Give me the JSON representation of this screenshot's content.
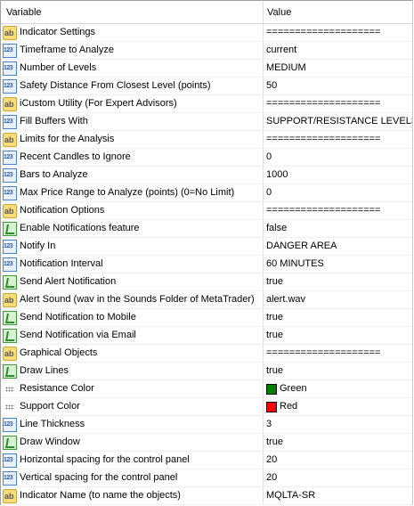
{
  "header": {
    "variable": "Variable",
    "value": "Value"
  },
  "rows": [
    {
      "icon": "ab",
      "label": "Indicator Settings",
      "value": "===================="
    },
    {
      "icon": "num",
      "label": "Timeframe to Analyze",
      "value": "current"
    },
    {
      "icon": "num",
      "label": "Number of Levels",
      "value": "MEDIUM"
    },
    {
      "icon": "num",
      "label": "Safety Distance From Closest Level (points)",
      "value": "50"
    },
    {
      "icon": "ab",
      "label": "iCustom Utility (For Expert Advisors)",
      "value": "===================="
    },
    {
      "icon": "num",
      "label": "Fill Buffers With",
      "value": "SUPPORT/RESISTANCE LEVELS"
    },
    {
      "icon": "ab",
      "label": "Limits for the Analysis",
      "value": "===================="
    },
    {
      "icon": "num",
      "label": "Recent Candles to Ignore",
      "value": "0"
    },
    {
      "icon": "num",
      "label": "Bars to Analyze",
      "value": "1000"
    },
    {
      "icon": "num",
      "label": "Max Price Range to Analyze (points) (0=No Limit)",
      "value": "0"
    },
    {
      "icon": "ab",
      "label": "Notification Options",
      "value": "===================="
    },
    {
      "icon": "bool",
      "label": "Enable Notifications feature",
      "value": "false"
    },
    {
      "icon": "num",
      "label": "Notify In",
      "value": "DANGER AREA"
    },
    {
      "icon": "num",
      "label": "Notification Interval",
      "value": "60 MINUTES"
    },
    {
      "icon": "bool",
      "label": "Send Alert Notification",
      "value": "true"
    },
    {
      "icon": "ab",
      "label": "Alert Sound (wav in the Sounds Folder of MetaTrader)",
      "value": "alert.wav"
    },
    {
      "icon": "bool",
      "label": "Send Notification to Mobile",
      "value": "true"
    },
    {
      "icon": "bool",
      "label": "Send Notification via Email",
      "value": "true"
    },
    {
      "icon": "ab",
      "label": "Graphical Objects",
      "value": "===================="
    },
    {
      "icon": "bool",
      "label": "Draw Lines",
      "value": "true"
    },
    {
      "icon": "color",
      "label": "Resistance Color",
      "value": "Green",
      "swatch": "#008000"
    },
    {
      "icon": "color",
      "label": "Support Color",
      "value": "Red",
      "swatch": "#ff0000"
    },
    {
      "icon": "num",
      "label": "Line Thickness",
      "value": "3"
    },
    {
      "icon": "bool",
      "label": "Draw Window",
      "value": "true"
    },
    {
      "icon": "num",
      "label": "Horizontal spacing for the control panel",
      "value": "20"
    },
    {
      "icon": "num",
      "label": "Vertical spacing for the control panel",
      "value": "20"
    },
    {
      "icon": "ab",
      "label": "Indicator Name (to name the objects)",
      "value": "MQLTA-SR"
    }
  ]
}
